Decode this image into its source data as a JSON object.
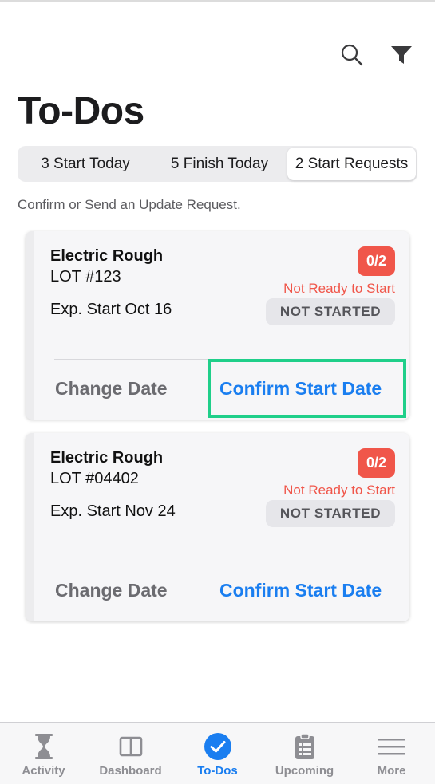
{
  "header": {
    "title": "To-Dos",
    "search_icon": "search-icon",
    "filter_icon": "filter-icon"
  },
  "segments": [
    {
      "label": "3 Start Today",
      "selected": false
    },
    {
      "label": "5 Finish Today",
      "selected": false
    },
    {
      "label": "2 Start Requests",
      "selected": true
    }
  ],
  "hint": "Confirm or Send an Update Request.",
  "cards": [
    {
      "task": "Electric Rough",
      "lot": "LOT #123",
      "exp_start": "Exp. Start Oct 16",
      "badge": "0/2",
      "status_text": "Not Ready to Start",
      "status_pill": "NOT STARTED",
      "change_label": "Change Date",
      "confirm_label": "Confirm Start Date"
    },
    {
      "task": "Electric Rough",
      "lot": "LOT #04402",
      "exp_start": "Exp. Start Nov 24",
      "badge": "0/2",
      "status_text": "Not Ready to Start",
      "status_pill": "NOT STARTED",
      "change_label": "Change Date",
      "confirm_label": "Confirm Start Date"
    }
  ],
  "tabbar": [
    {
      "label": "Activity",
      "icon": "hourglass-icon",
      "active": false
    },
    {
      "label": "Dashboard",
      "icon": "dashboard-icon",
      "active": false
    },
    {
      "label": "To-Dos",
      "icon": "checkmark-circle-icon",
      "active": true
    },
    {
      "label": "Upcoming",
      "icon": "clipboard-icon",
      "active": false
    },
    {
      "label": "More",
      "icon": "menu-icon",
      "active": false
    }
  ],
  "colors": {
    "accent": "#1a7ef0",
    "badge": "#f0564a",
    "highlight": "#1fcf8a"
  }
}
